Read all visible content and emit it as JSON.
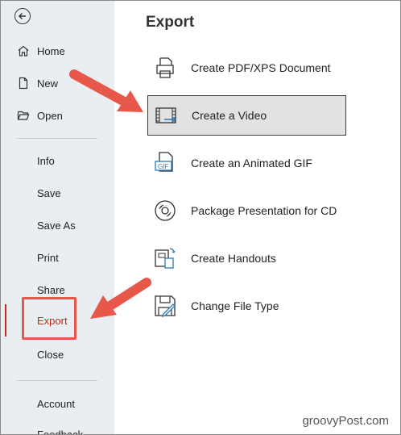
{
  "sidebar": {
    "back_label": "",
    "primary": [
      {
        "label": "Home",
        "icon": "home-icon"
      },
      {
        "label": "New",
        "icon": "new-document-icon"
      },
      {
        "label": "Open",
        "icon": "open-folder-icon"
      }
    ],
    "secondary": [
      {
        "label": "Info"
      },
      {
        "label": "Save"
      },
      {
        "label": "Save As"
      },
      {
        "label": "Print"
      },
      {
        "label": "Share"
      },
      {
        "label": "Export",
        "active": true
      },
      {
        "label": "Close"
      }
    ],
    "footer": [
      {
        "label": "Account"
      },
      {
        "label": "Feedback"
      }
    ]
  },
  "main": {
    "title": "Export",
    "options": [
      {
        "label": "Create PDF/XPS Document",
        "icon": "pdf-printer-icon"
      },
      {
        "label": "Create a Video",
        "icon": "video-icon",
        "selected": true
      },
      {
        "label": "Create an Animated GIF",
        "icon": "gif-icon"
      },
      {
        "label": "Package Presentation for CD",
        "icon": "cd-icon"
      },
      {
        "label": "Create Handouts",
        "icon": "handouts-icon"
      },
      {
        "label": "Change File Type",
        "icon": "change-file-type-icon"
      }
    ]
  },
  "watermark": "groovyPost.com",
  "colors": {
    "accent": "#c42b1c",
    "arrow": "#e8584a",
    "sidebar_bg": "#e8eef1"
  }
}
